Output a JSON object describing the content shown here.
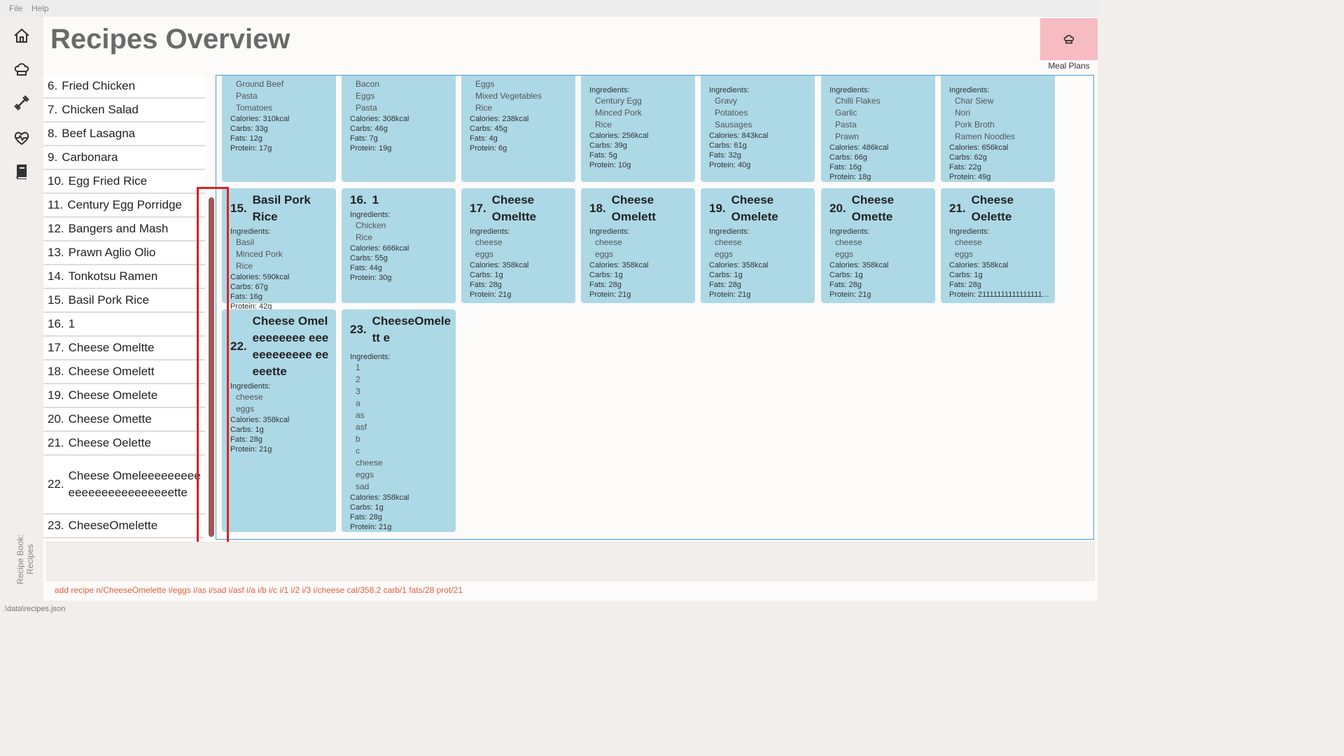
{
  "menu": [
    "File",
    "Help"
  ],
  "sidebar": {
    "icons": [
      "home-icon",
      "chef-hat-icon",
      "dumbbell-icon",
      "heartbeat-icon",
      "book-icon"
    ],
    "vertical_label": "Recipe Book:\nRecipes"
  },
  "header": {
    "title": "Recipes Overview",
    "meal_plans_label": "Meal Plans"
  },
  "recipe_list": [
    {
      "num": "6.",
      "name": "Fried Chicken"
    },
    {
      "num": "7.",
      "name": "Chicken Salad"
    },
    {
      "num": "8.",
      "name": "Beef Lasagna"
    },
    {
      "num": "9.",
      "name": "Carbonara"
    },
    {
      "num": "10.",
      "name": "Egg Fried Rice"
    },
    {
      "num": "11.",
      "name": "Century Egg Porridge"
    },
    {
      "num": "12.",
      "name": "Bangers and Mash"
    },
    {
      "num": "13.",
      "name": "Prawn Aglio Olio"
    },
    {
      "num": "14.",
      "name": "Tonkotsu Ramen"
    },
    {
      "num": "15.",
      "name": "Basil Pork Rice"
    },
    {
      "num": "16.",
      "name": "1"
    },
    {
      "num": "17.",
      "name": "Cheese Omeltte"
    },
    {
      "num": "18.",
      "name": "Cheese Omelett"
    },
    {
      "num": "19.",
      "name": "Cheese Omelete"
    },
    {
      "num": "20.",
      "name": "Cheese Omette"
    },
    {
      "num": "21.",
      "name": "Cheese Oelette"
    },
    {
      "num": "22.",
      "name": "Cheese Omeleeeeeeeeeeeeeeeeeeeeeeeeette"
    },
    {
      "num": "23.",
      "name": "CheeseOmelette"
    }
  ],
  "cards_row1": [
    {
      "ingredients": [
        "Ground Beef",
        "Pasta",
        "Tomatoes"
      ],
      "calories": "Calories: 310kcal",
      "carbs": "Carbs: 33g",
      "fats": "Fats: 12g",
      "protein": "Protein: 17g"
    },
    {
      "ingredients": [
        "Bacon",
        "Eggs",
        "Pasta"
      ],
      "calories": "Calories: 308kcal",
      "carbs": "Carbs: 46g",
      "fats": "Fats: 7g",
      "protein": "Protein: 19g"
    },
    {
      "ingredients": [
        "Eggs",
        "Mixed Vegetables",
        "Rice"
      ],
      "calories": "Calories: 238kcal",
      "carbs": "Carbs: 45g",
      "fats": "Fats: 4g",
      "protein": "Protein: 6g"
    },
    {
      "label": "Ingredients:",
      "ingredients": [
        "Century Egg",
        "Minced Pork",
        "Rice"
      ],
      "calories": "Calories: 256kcal",
      "carbs": "Carbs: 39g",
      "fats": "Fats: 5g",
      "protein": "Protein: 10g"
    },
    {
      "label": "Ingredients:",
      "ingredients": [
        "Gravy",
        "Potatoes",
        "Sausages"
      ],
      "calories": "Calories: 843kcal",
      "carbs": "Carbs: 61g",
      "fats": "Fats: 32g",
      "protein": "Protein: 40g"
    },
    {
      "label": "Ingredients:",
      "ingredients": [
        "Chilli Flakes",
        "Garlic",
        "Pasta",
        "Prawn"
      ],
      "calories": "Calories: 486kcal",
      "carbs": "Carbs: 66g",
      "fats": "Fats: 16g",
      "protein": "Protein: 18g"
    },
    {
      "label": "Ingredients:",
      "ingredients": [
        "Char Siew",
        "Nori",
        "Pork Broth",
        "Ramen Noodles"
      ],
      "calories": "Calories: 656kcal",
      "carbs": "Carbs: 62g",
      "fats": "Fats: 22g",
      "protein": "Protein: 49g"
    }
  ],
  "cards_row2": [
    {
      "num": "15.",
      "name": "Basil Pork Rice",
      "label": "Ingredients:",
      "ingredients": [
        "Basil",
        "Minced Pork",
        "Rice"
      ],
      "calories": "Calories: 590kcal",
      "carbs": "Carbs: 67g",
      "fats": "Fats: 16g",
      "protein": "Protein: 42g"
    },
    {
      "num": "16.",
      "name": "1",
      "label": "Ingredients:",
      "ingredients": [
        "Chicken",
        "Rice"
      ],
      "calories": "Calories: 666kcal",
      "carbs": "Carbs: 55g",
      "fats": "Fats: 44g",
      "protein": "Protein: 30g"
    },
    {
      "num": "17.",
      "name": "Cheese Omeltte",
      "label": "Ingredients:",
      "ingredients": [
        "cheese",
        "eggs"
      ],
      "calories": "Calories: 358kcal",
      "carbs": "Carbs: 1g",
      "fats": "Fats: 28g",
      "protein": "Protein: 21g"
    },
    {
      "num": "18.",
      "name": "Cheese Omelett",
      "label": "Ingredients:",
      "ingredients": [
        "cheese",
        "eggs"
      ],
      "calories": "Calories: 358kcal",
      "carbs": "Carbs: 1g",
      "fats": "Fats: 28g",
      "protein": "Protein: 21g"
    },
    {
      "num": "19.",
      "name": "Cheese Omelete",
      "label": "Ingredients:",
      "ingredients": [
        "cheese",
        "eggs"
      ],
      "calories": "Calories: 358kcal",
      "carbs": "Carbs: 1g",
      "fats": "Fats: 28g",
      "protein": "Protein: 21g"
    },
    {
      "num": "20.",
      "name": "Cheese Omette",
      "label": "Ingredients:",
      "ingredients": [
        "cheese",
        "eggs"
      ],
      "calories": "Calories: 358kcal",
      "carbs": "Carbs: 1g",
      "fats": "Fats: 28g",
      "protein": "Protein: 21g"
    },
    {
      "num": "21.",
      "name": "Cheese Oelette",
      "label": "Ingredients:",
      "ingredients": [
        "cheese",
        "eggs"
      ],
      "calories": "Calories: 358kcal",
      "carbs": "Carbs: 1g",
      "fats": "Fats: 28g",
      "protein": "Protein: 2111111111111111111..."
    }
  ],
  "cards_row3": [
    {
      "num": "22.",
      "name": "Cheese Omeleeeeeeee eeeeeeeeeeee eeeeette",
      "label": "Ingredients:",
      "ingredients": [
        "cheese",
        "eggs"
      ],
      "calories": "Calories: 358kcal",
      "carbs": "Carbs: 1g",
      "fats": "Fats: 28g",
      "protein": "Protein: 21g"
    },
    {
      "num": "23.",
      "name": "CheeseOmelett e",
      "label": "Ingredients:",
      "ingredients": [
        "1",
        "2",
        "3",
        "a",
        "as",
        "asf",
        "b",
        "c",
        "cheese",
        "eggs",
        "sad"
      ],
      "calories": "Calories: 358kcal",
      "carbs": "Carbs: 1g",
      "fats": "Fats: 28g",
      "protein": "Protein: 21g"
    }
  ],
  "command_result": "add recipe n/CheeseOmelette i/eggs i/as i/sad i/asf i/a i/b i/c i/1 i/2 i/3 i/cheese cal/358.2 carb/1 fats/28 prot/21",
  "status_bar": ".\\data\\recipes.json"
}
